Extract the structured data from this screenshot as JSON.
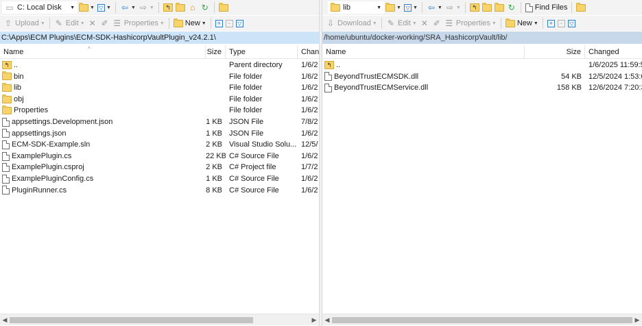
{
  "left": {
    "drive": "C: Local Disk",
    "toolbar2": {
      "upload": "Upload",
      "edit": "Edit",
      "properties": "Properties",
      "new": "New"
    },
    "path": "C:\\Apps\\ECM Plugins\\ECM-SDK-HashicorpVaultPlugin_v24.2.1\\",
    "columns": {
      "name": "Name",
      "size": "Size",
      "type": "Type",
      "changed": "Chan"
    },
    "rows": [
      {
        "name": "..",
        "size": "",
        "type": "Parent directory",
        "changed": "1/6/2",
        "icon": "parent-dir-icon"
      },
      {
        "name": "bin",
        "size": "",
        "type": "File folder",
        "changed": "1/6/2",
        "icon": "folder-icon"
      },
      {
        "name": "lib",
        "size": "",
        "type": "File folder",
        "changed": "1/6/2",
        "icon": "folder-icon"
      },
      {
        "name": "obj",
        "size": "",
        "type": "File folder",
        "changed": "1/6/2",
        "icon": "folder-icon"
      },
      {
        "name": "Properties",
        "size": "",
        "type": "File folder",
        "changed": "1/6/2",
        "icon": "folder-icon"
      },
      {
        "name": "appsettings.Development.json",
        "size": "1 KB",
        "type": "JSON File",
        "changed": "7/8/2",
        "icon": "json-file-icon"
      },
      {
        "name": "appsettings.json",
        "size": "1 KB",
        "type": "JSON File",
        "changed": "1/6/2",
        "icon": "json-file-icon"
      },
      {
        "name": "ECM-SDK-Example.sln",
        "size": "2 KB",
        "type": "Visual Studio Solu...",
        "changed": "12/5/",
        "icon": "solution-file-icon"
      },
      {
        "name": "ExamplePlugin.cs",
        "size": "22 KB",
        "type": "C# Source File",
        "changed": "1/6/2",
        "icon": "cs-file-icon"
      },
      {
        "name": "ExamplePlugin.csproj",
        "size": "2 KB",
        "type": "C# Project file",
        "changed": "1/7/2",
        "icon": "csproj-file-icon"
      },
      {
        "name": "ExamplePluginConfig.cs",
        "size": "1 KB",
        "type": "C# Source File",
        "changed": "1/6/2",
        "icon": "cs-file-icon"
      },
      {
        "name": "PluginRunner.cs",
        "size": "8 KB",
        "type": "C# Source File",
        "changed": "1/6/2",
        "icon": "cs-file-icon"
      }
    ]
  },
  "right": {
    "location": "lib",
    "find_files": "Find Files",
    "toolbar2": {
      "download": "Download",
      "edit": "Edit",
      "properties": "Properties",
      "new": "New"
    },
    "path": "/home/ubuntu/docker-working/SRA_HashicorpVault/lib/",
    "columns": {
      "name": "Name",
      "size": "Size",
      "changed": "Changed"
    },
    "rows": [
      {
        "name": "..",
        "size": "",
        "changed": "1/6/2025 11:59:5",
        "icon": "parent-dir-icon"
      },
      {
        "name": "BeyondTrustECMSDK.dll",
        "size": "54 KB",
        "changed": "12/5/2024 1:53:0",
        "icon": "dll-file-icon"
      },
      {
        "name": "BeyondTrustECMService.dll",
        "size": "158 KB",
        "changed": "12/6/2024 7:20:3",
        "icon": "dll-file-icon"
      }
    ]
  },
  "icons": {
    "drive": "hard-drive-icon",
    "open_folder": "open-folder-icon",
    "filter": "filter-icon",
    "back": "back-arrow-icon",
    "forward": "forward-arrow-icon",
    "parent": "parent-directory-icon",
    "root": "root-directory-icon",
    "home": "home-icon",
    "refresh": "refresh-icon",
    "sync": "synchronize-browsing-icon"
  },
  "colors": {
    "left_path_bg": "#cde3f7",
    "right_path_bg": "#c7d8ea",
    "folder": "#f6d36b",
    "accent": "#2a7fd4"
  }
}
